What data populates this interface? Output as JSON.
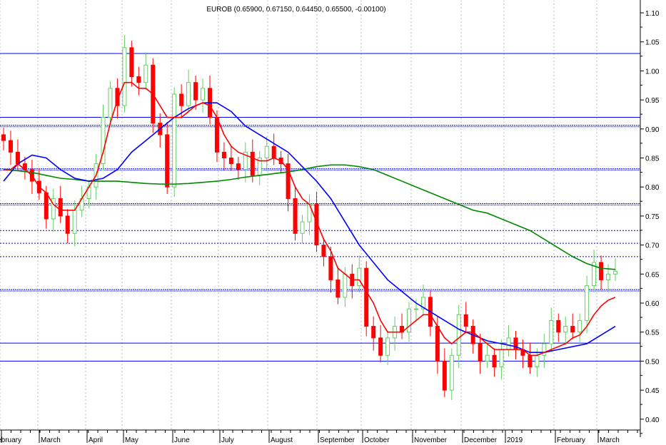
{
  "chart_data": {
    "type": "candlestick",
    "title": "EUROB (0.65900, 0.67150, 0.64450, 0.65500, -0.00100)",
    "ylim": [
      0.38,
      1.12
    ],
    "y_ticks": [
      "1.10",
      "1.05",
      "1.00",
      "0.95",
      "0.90",
      "0.85",
      "0.80",
      "0.75",
      "0.70",
      "0.65",
      "0.60",
      "0.55",
      "0.50",
      "0.45",
      "0.40"
    ],
    "x_labels": [
      "February",
      "March",
      "April",
      "May",
      "June",
      "July",
      "August",
      "September",
      "October",
      "November",
      "December",
      "2019",
      "February",
      "March"
    ],
    "grid": "vertical dotted at month starts",
    "colors": {
      "up": "#66cc66",
      "down": "#ff0000",
      "ma_short": "#ff0000",
      "ma_mid": "#0000ff",
      "ma_long": "#008800",
      "hlines": "#0000ff"
    },
    "closes": [
      0.88,
      0.86,
      0.84,
      0.83,
      0.81,
      0.79,
      0.745,
      0.78,
      0.75,
      0.72,
      0.76,
      0.78,
      0.8,
      0.84,
      0.92,
      0.97,
      0.94,
      1.04,
      0.99,
      0.98,
      1.01,
      0.91,
      0.89,
      0.8,
      0.96,
      0.94,
      0.98,
      0.95,
      0.97,
      0.92,
      0.86,
      0.85,
      0.84,
      0.83,
      0.86,
      0.82,
      0.85,
      0.87,
      0.85,
      0.84,
      0.78,
      0.72,
      0.74,
      0.77,
      0.7,
      0.68,
      0.64,
      0.61,
      0.65,
      0.63,
      0.66,
      0.56,
      0.54,
      0.51,
      0.54,
      0.56,
      0.55,
      0.59,
      0.59,
      0.61,
      0.56,
      0.5,
      0.45,
      0.51,
      0.58,
      0.56,
      0.53,
      0.5,
      0.51,
      0.49,
      0.52,
      0.54,
      0.52,
      0.51,
      0.49,
      0.51,
      0.53,
      0.57,
      0.55,
      0.56,
      0.55,
      0.57,
      0.63,
      0.67,
      0.64,
      0.65,
      0.655
    ],
    "ma_short": [
      0.83,
      0.83,
      0.84,
      0.83,
      0.82,
      0.8,
      0.79,
      0.77,
      0.76,
      0.76,
      0.76,
      0.78,
      0.8,
      0.82,
      0.86,
      0.91,
      0.95,
      0.98,
      0.98,
      0.97,
      0.97,
      0.96,
      0.94,
      0.92,
      0.92,
      0.92,
      0.93,
      0.94,
      0.945,
      0.94,
      0.92,
      0.89,
      0.87,
      0.86,
      0.855,
      0.85,
      0.845,
      0.845,
      0.85,
      0.845,
      0.83,
      0.8,
      0.78,
      0.77,
      0.74,
      0.71,
      0.69,
      0.66,
      0.65,
      0.64,
      0.64,
      0.62,
      0.6,
      0.57,
      0.55,
      0.55,
      0.55,
      0.56,
      0.57,
      0.58,
      0.58,
      0.56,
      0.54,
      0.53,
      0.54,
      0.55,
      0.55,
      0.54,
      0.53,
      0.52,
      0.52,
      0.52,
      0.52,
      0.52,
      0.51,
      0.51,
      0.515,
      0.52,
      0.525,
      0.53,
      0.54,
      0.545,
      0.56,
      0.58,
      0.595,
      0.605,
      0.61
    ],
    "ma_mid": [
      0.81,
      0.84,
      0.855,
      0.85,
      0.83,
      0.815,
      0.81,
      0.815,
      0.83,
      0.86,
      0.88,
      0.9,
      0.92,
      0.935,
      0.945,
      0.945,
      0.93,
      0.905,
      0.89,
      0.875,
      0.86,
      0.835,
      0.81,
      0.78,
      0.74,
      0.7,
      0.67,
      0.64,
      0.62,
      0.6,
      0.585,
      0.57,
      0.555,
      0.545,
      0.535,
      0.53,
      0.525,
      0.515,
      0.515,
      0.52,
      0.525,
      0.53,
      0.545,
      0.56
    ],
    "ma_long": [
      0.83,
      0.828,
      0.825,
      0.82,
      0.815,
      0.813,
      0.81,
      0.81,
      0.81,
      0.808,
      0.806,
      0.805,
      0.805,
      0.806,
      0.808,
      0.81,
      0.813,
      0.817,
      0.82,
      0.823,
      0.826,
      0.83,
      0.835,
      0.838,
      0.838,
      0.835,
      0.83,
      0.82,
      0.81,
      0.8,
      0.79,
      0.78,
      0.77,
      0.76,
      0.755,
      0.745,
      0.735,
      0.725,
      0.71,
      0.695,
      0.68,
      0.668,
      0.66,
      0.658
    ],
    "hlines": [
      {
        "value": 1.03,
        "style": "solid"
      },
      {
        "value": 0.92,
        "style": "solid"
      },
      {
        "value": 0.905,
        "style": "double-dotted"
      },
      {
        "value": 0.83,
        "style": "double-dotted"
      },
      {
        "value": 0.77,
        "style": "double-dotted"
      },
      {
        "value": 0.725,
        "style": "dotted"
      },
      {
        "value": 0.703,
        "style": "dotted"
      },
      {
        "value": 0.68,
        "style": "dotted"
      },
      {
        "value": 0.622,
        "style": "double-dotted"
      },
      {
        "value": 0.531,
        "style": "solid"
      },
      {
        "value": 0.5,
        "style": "solid"
      }
    ]
  }
}
